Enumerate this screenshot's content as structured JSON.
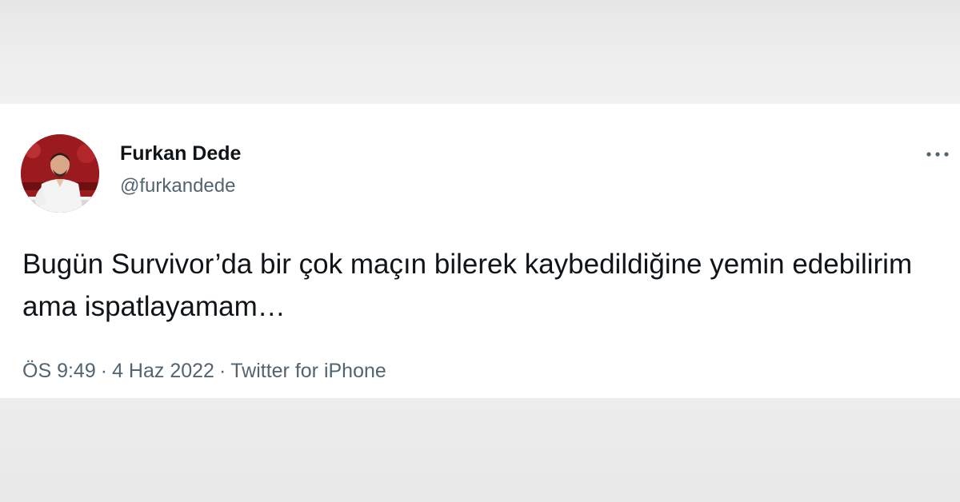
{
  "tweet": {
    "author": {
      "name": "Furkan Dede",
      "handle": "@furkandede"
    },
    "text": "Bugün Survivor’da bir çok maçın bilerek kaybedildiğine yemin edebilirim ama ispatlayamam…",
    "meta": {
      "time": "ÖS 9:49",
      "separator": "·",
      "date": "4 Haz 2022",
      "source": "Twitter for iPhone"
    },
    "more_icon": "more-horizontal-icon"
  },
  "colors": {
    "text_primary": "#0f1419",
    "text_secondary": "#536471",
    "card_background": "#ffffff",
    "page_background": "#ededed"
  }
}
